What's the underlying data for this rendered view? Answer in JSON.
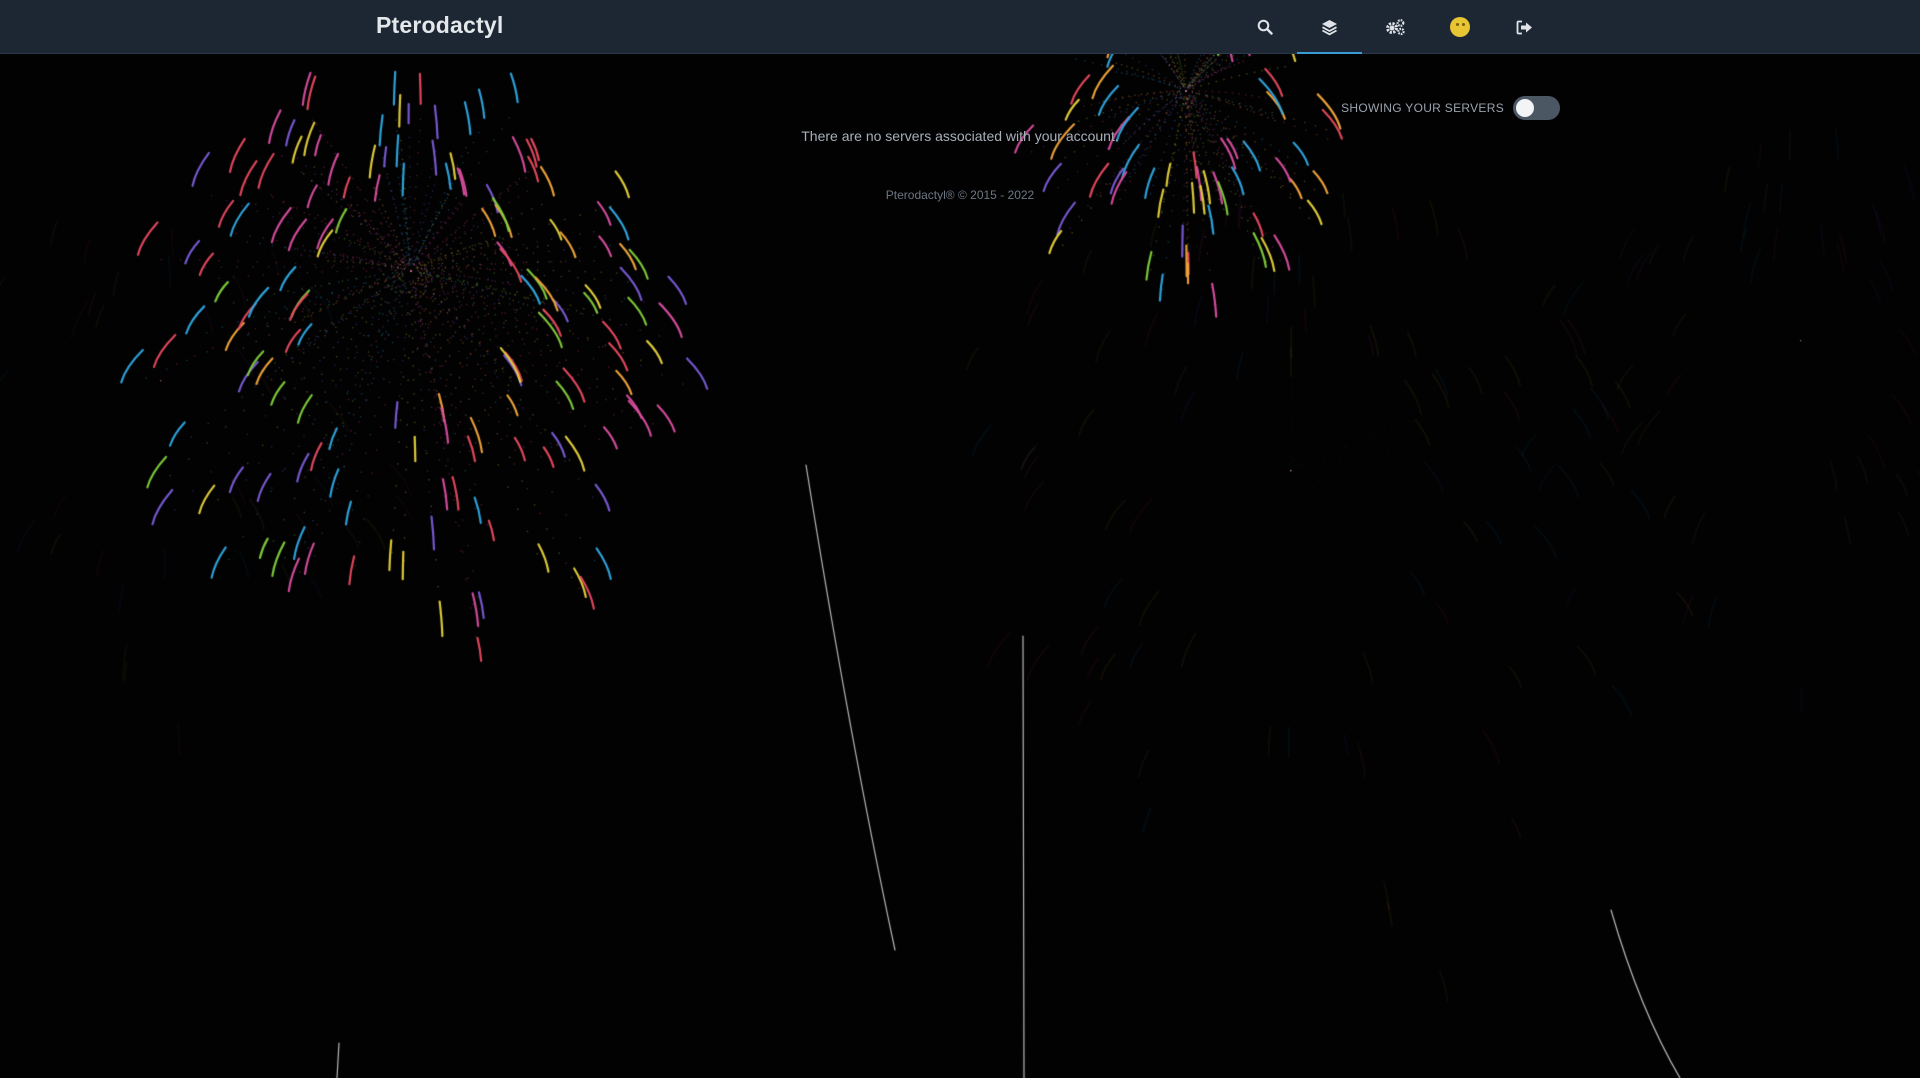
{
  "navbar": {
    "brand": "Pterodactyl",
    "icons": [
      "search-icon",
      "layers-icon",
      "cogs-icon",
      "avatar-icon",
      "sign-out-icon"
    ],
    "active": "layers-icon",
    "accent_color": "#3b9bd6"
  },
  "servers": {
    "toggle_label": "SHOWING YOUR SERVERS",
    "toggle_on": false,
    "empty_message": "There are no servers associated with your account."
  },
  "footer": {
    "text": "Pterodactyl® © 2015 - 2022"
  },
  "colors": {
    "background": "#020203",
    "navbar": "#1c2733",
    "firework_palette": [
      "#e84a5f",
      "#f4a63a",
      "#e6d23a",
      "#7fcf3a",
      "#2fa8e0",
      "#7a5cd6",
      "#d94ea0"
    ]
  }
}
